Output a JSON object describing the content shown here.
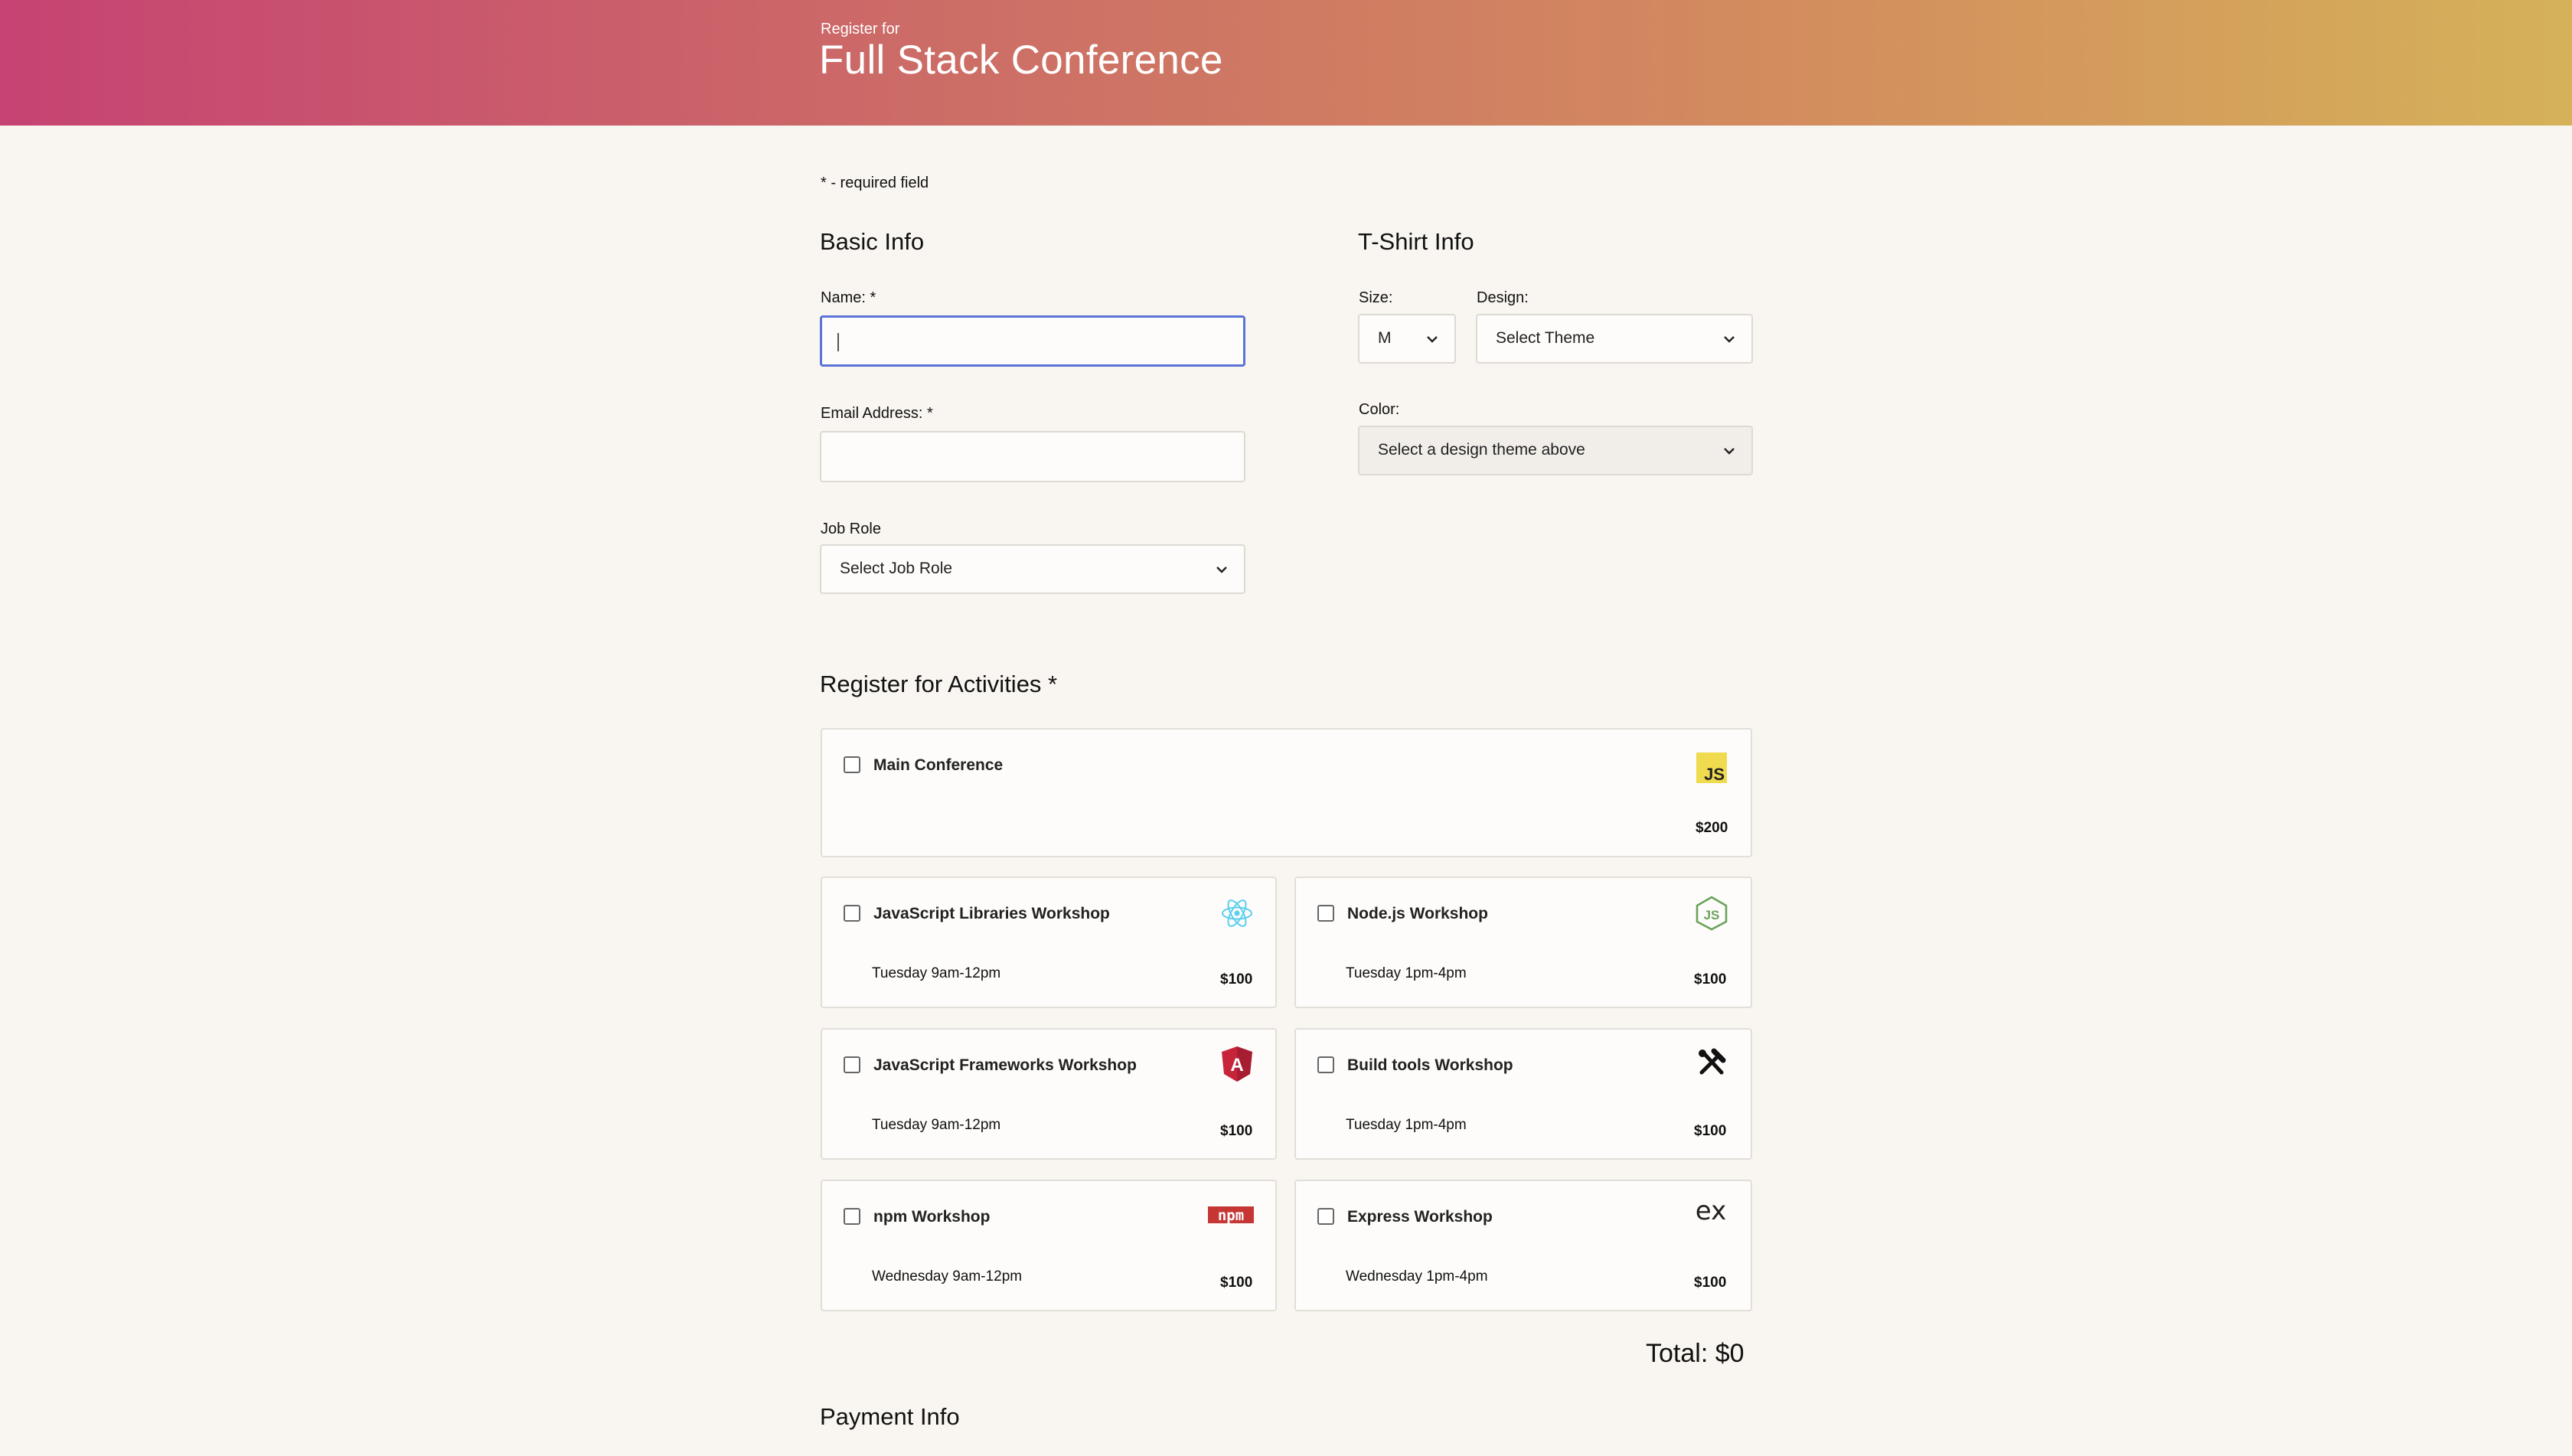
{
  "header": {
    "subtitle": "Register for",
    "title": "Full Stack Conference"
  },
  "required_note": "* - required field",
  "basic_info": {
    "heading": "Basic Info",
    "name_label": "Name: *",
    "name_value": "",
    "email_label": "Email Address: *",
    "email_value": "",
    "job_role_label": "Job Role",
    "job_role_value": "Select Job Role"
  },
  "tshirt_info": {
    "heading": "T-Shirt Info",
    "size_label": "Size:",
    "size_value": "M",
    "design_label": "Design:",
    "design_value": "Select Theme",
    "color_label": "Color:",
    "color_value": "Select a design theme above"
  },
  "activities": {
    "heading": "Register for Activities *",
    "items": [
      {
        "title": "Main Conference",
        "time": "",
        "price": "$200",
        "icon": "javascript-icon"
      },
      {
        "title": "JavaScript Libraries Workshop",
        "time": "Tuesday 9am-12pm",
        "price": "$100",
        "icon": "react-icon"
      },
      {
        "title": "Node.js Workshop",
        "time": "Tuesday 1pm-4pm",
        "price": "$100",
        "icon": "nodejs-icon"
      },
      {
        "title": "JavaScript Frameworks Workshop",
        "time": "Tuesday 9am-12pm",
        "price": "$100",
        "icon": "angular-icon"
      },
      {
        "title": "Build tools Workshop",
        "time": "Tuesday 1pm-4pm",
        "price": "$100",
        "icon": "tools-icon"
      },
      {
        "title": "npm Workshop",
        "time": "Wednesday 9am-12pm",
        "price": "$100",
        "icon": "npm-icon"
      },
      {
        "title": "Express Workshop",
        "time": "Wednesday 1pm-4pm",
        "price": "$100",
        "icon": "express-icon"
      }
    ]
  },
  "total": "Total: $0",
  "payment_heading": "Payment Info",
  "colors": {
    "header_start": "#c64373",
    "header_end": "#d5b259",
    "focus": "#5b73d9"
  }
}
